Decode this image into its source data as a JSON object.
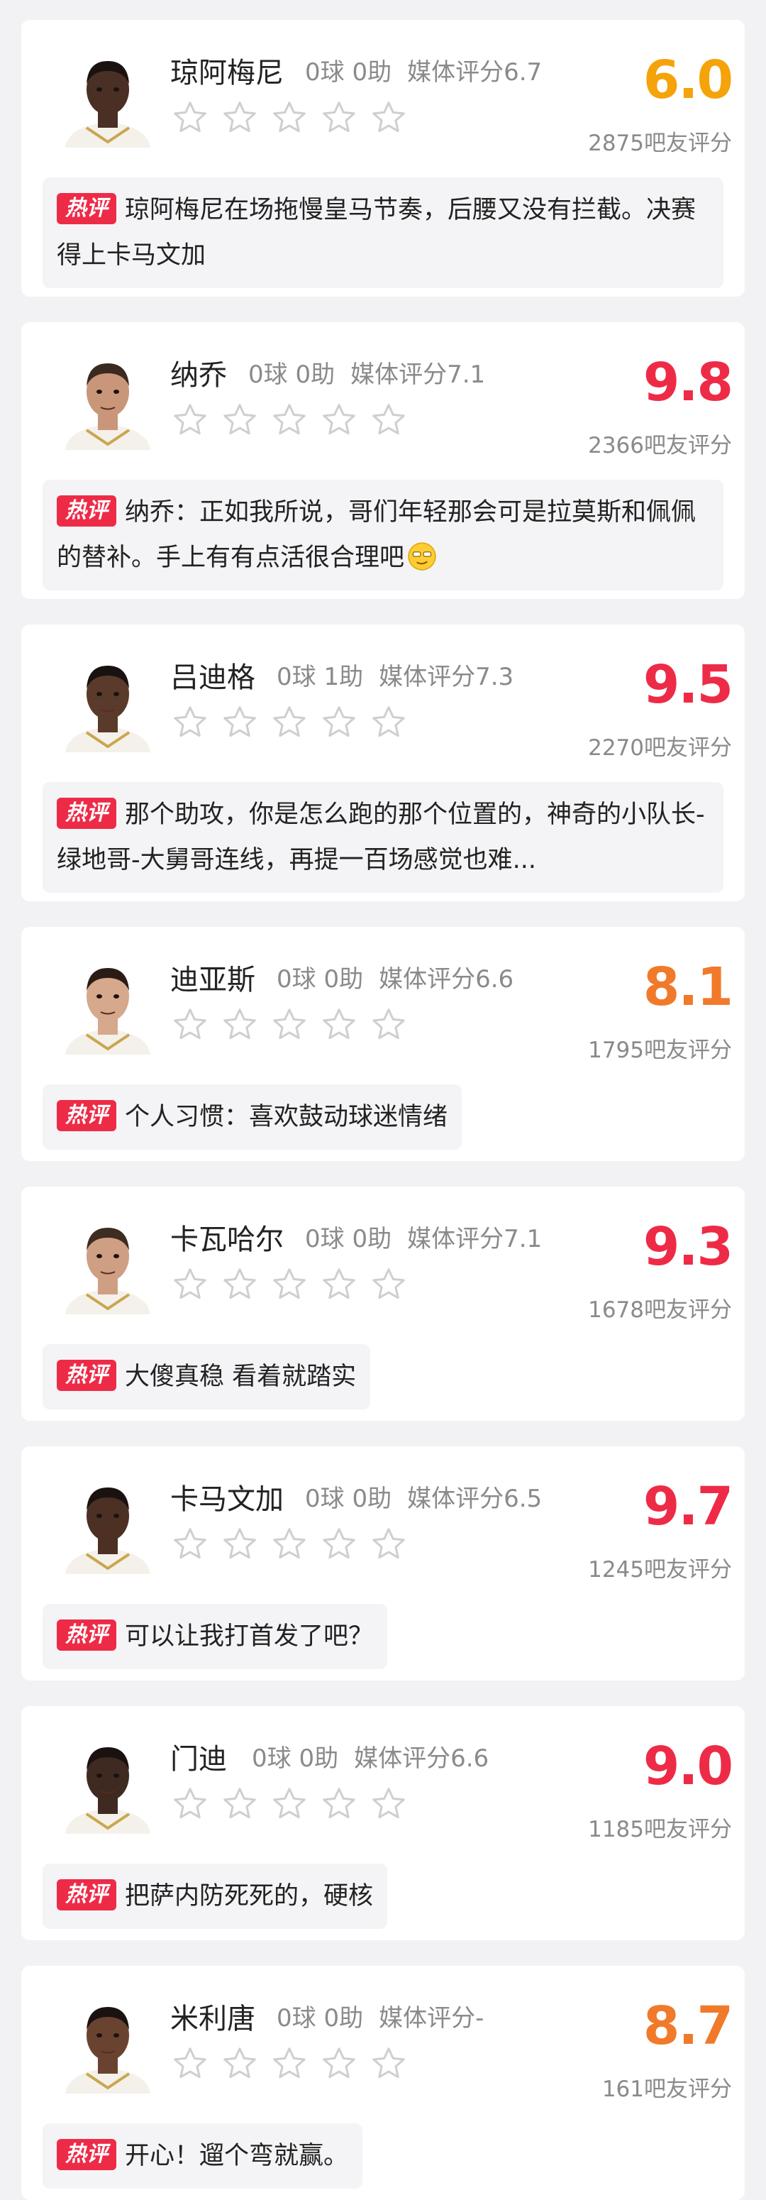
{
  "badge_label": "热评",
  "colors": {
    "red": "#ee2b47",
    "orange": "#f07a2a",
    "gold": "#f5a30b",
    "star_outline": "#cfcfcf"
  },
  "players": [
    {
      "name": "琼阿梅尼",
      "stats": "0球 0助",
      "media_rating": "媒体评分6.7",
      "score": "6.0",
      "score_color": "#f5a30b",
      "fan_count": "2875吧友评分",
      "comment": "琼阿梅尼在场拖慢皇马节奏，后腰又没有拦截。决赛得上卡马文加",
      "avatar_icon": "player-photo"
    },
    {
      "name": "纳乔",
      "stats": "0球 0助",
      "media_rating": "媒体评分7.1",
      "score": "9.8",
      "score_color": "#ee2b47",
      "fan_count": "2366吧友评分",
      "comment": "纳乔：正如我所说，哥们年轻那会可是拉莫斯和佩佩的替补。手上有有点活很合理吧",
      "emoji": "smirk-emoji",
      "avatar_icon": "player-photo"
    },
    {
      "name": "吕迪格",
      "stats": "0球 1助",
      "media_rating": "媒体评分7.3",
      "score": "9.5",
      "score_color": "#ee2b47",
      "fan_count": "2270吧友评分",
      "comment": "那个助攻，你是怎么跑的那个位置的，神奇的小队长-绿地哥-大舅哥连线，再提一百场感觉也难...",
      "avatar_icon": "player-photo"
    },
    {
      "name": "迪亚斯",
      "stats": "0球 0助",
      "media_rating": "媒体评分6.6",
      "score": "8.1",
      "score_color": "#f07a2a",
      "fan_count": "1795吧友评分",
      "comment": "个人习惯：喜欢鼓动球迷情绪",
      "avatar_icon": "player-photo"
    },
    {
      "name": "卡瓦哈尔",
      "stats": "0球 0助",
      "media_rating": "媒体评分7.1",
      "score": "9.3",
      "score_color": "#ee2b47",
      "fan_count": "1678吧友评分",
      "comment": "大傻真稳 看着就踏实",
      "avatar_icon": "player-photo"
    },
    {
      "name": "卡马文加",
      "stats": "0球 0助",
      "media_rating": "媒体评分6.5",
      "score": "9.7",
      "score_color": "#ee2b47",
      "fan_count": "1245吧友评分",
      "comment": "可以让我打首发了吧？",
      "avatar_icon": "player-photo"
    },
    {
      "name": "门迪",
      "stats": "0球 0助",
      "media_rating": "媒体评分6.6",
      "score": "9.0",
      "score_color": "#ee2b47",
      "fan_count": "1185吧友评分",
      "comment": "把萨内防死死的，硬核",
      "avatar_icon": "player-photo"
    },
    {
      "name": "米利唐",
      "stats": "0球 0助",
      "media_rating": "媒体评分-",
      "score": "8.7",
      "score_color": "#f07a2a",
      "fan_count": "161吧友评分",
      "comment": "开心！遛个弯就赢。",
      "avatar_icon": "player-photo"
    }
  ]
}
